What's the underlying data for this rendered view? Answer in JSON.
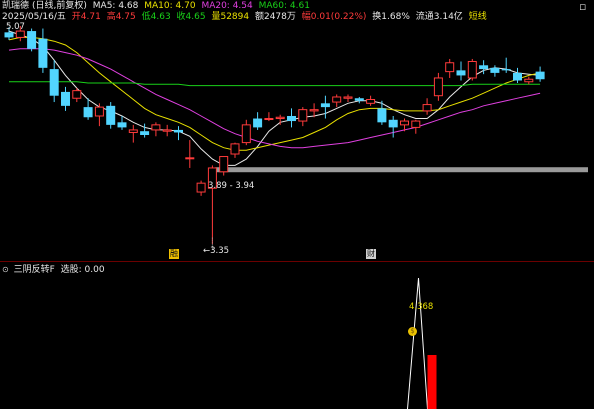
{
  "header": {
    "stock": "凯瑞德",
    "period_adj": "(日线,前复权)",
    "ma5": "MA5: 4.68",
    "ma10": "MA10: 4.70",
    "ma20": "MA20: 4.54",
    "ma60": "MA60: 4.61"
  },
  "info": {
    "date": "2025/05/16/五",
    "open": "开4.71",
    "high": "高4.75",
    "low": "低4.63",
    "close": "收4.65",
    "volume": "量52894",
    "amount": "额2478万",
    "change": "幅0.01(0.22%)",
    "turnover": "换1.68%",
    "float_cap": "流通3.14亿",
    "extra": "短线"
  },
  "chart": {
    "price_labels": [
      "5.07",
      "3.89 - 3.94",
      "3.35"
    ],
    "markers": [
      "融",
      "财"
    ]
  },
  "indicator": {
    "name": "三阴反转F",
    "value_label": "选股: 0.00",
    "peak_label": "4.368"
  },
  "colors": {
    "up": "#ff3b3b",
    "down": "#52d5ff",
    "ma5": "#e8e8e8",
    "ma10": "#e8e000",
    "ma20": "#e040e0",
    "ma60": "#19d119",
    "support_band": "#9a9a9a"
  },
  "icons": [
    "minimize-icon",
    "settings-dot-icon"
  ],
  "chart_data": {
    "type": "candlestick",
    "price_high_label": 5.07,
    "price_low_label": 3.35,
    "support_band": [
      3.89,
      3.94
    ],
    "candles_ohlc": [
      [
        5.02,
        5.06,
        4.96,
        4.98
      ],
      [
        4.98,
        5.07,
        4.95,
        5.03
      ],
      [
        5.03,
        5.05,
        4.87,
        4.89
      ],
      [
        4.97,
        5.05,
        4.7,
        4.74
      ],
      [
        4.73,
        4.8,
        4.47,
        4.52
      ],
      [
        4.55,
        4.59,
        4.4,
        4.44
      ],
      [
        4.5,
        4.58,
        4.47,
        4.56
      ],
      [
        4.43,
        4.5,
        4.33,
        4.35
      ],
      [
        4.36,
        4.46,
        4.28,
        4.43
      ],
      [
        4.44,
        4.47,
        4.26,
        4.29
      ],
      [
        4.31,
        4.36,
        4.25,
        4.27
      ],
      [
        4.23,
        4.29,
        4.15,
        4.25
      ],
      [
        4.24,
        4.3,
        4.19,
        4.21
      ],
      [
        4.25,
        4.31,
        4.2,
        4.29
      ],
      [
        4.24,
        4.29,
        4.2,
        4.25
      ],
      [
        4.25,
        4.28,
        4.17,
        4.23
      ],
      [
        4.03,
        4.17,
        3.95,
        4.03
      ],
      [
        3.76,
        3.85,
        3.73,
        3.83
      ],
      [
        3.79,
        3.97,
        3.35,
        3.95
      ],
      [
        3.92,
        4.04,
        3.89,
        4.04
      ],
      [
        4.06,
        4.15,
        4.03,
        4.14
      ],
      [
        4.15,
        4.33,
        4.13,
        4.29
      ],
      [
        4.34,
        4.39,
        4.25,
        4.27
      ],
      [
        4.34,
        4.39,
        4.32,
        4.34
      ],
      [
        4.34,
        4.37,
        4.29,
        4.35
      ],
      [
        4.36,
        4.42,
        4.27,
        4.32
      ],
      [
        4.32,
        4.43,
        4.28,
        4.41
      ],
      [
        4.4,
        4.46,
        4.35,
        4.41
      ],
      [
        4.46,
        4.52,
        4.34,
        4.43
      ],
      [
        4.47,
        4.53,
        4.43,
        4.51
      ],
      [
        4.5,
        4.53,
        4.47,
        4.51
      ],
      [
        4.5,
        4.51,
        4.46,
        4.48
      ],
      [
        4.46,
        4.52,
        4.44,
        4.49
      ],
      [
        4.42,
        4.48,
        4.29,
        4.31
      ],
      [
        4.33,
        4.36,
        4.19,
        4.27
      ],
      [
        4.29,
        4.34,
        4.24,
        4.32
      ],
      [
        4.27,
        4.33,
        4.22,
        4.32
      ],
      [
        4.4,
        4.5,
        4.37,
        4.45
      ],
      [
        4.52,
        4.7,
        4.48,
        4.66
      ],
      [
        4.71,
        4.81,
        4.66,
        4.78
      ],
      [
        4.72,
        4.79,
        4.64,
        4.68
      ],
      [
        4.66,
        4.81,
        4.64,
        4.79
      ],
      [
        4.76,
        4.8,
        4.69,
        4.73
      ],
      [
        4.74,
        4.76,
        4.67,
        4.7
      ],
      [
        4.73,
        4.82,
        4.7,
        4.72
      ],
      [
        4.7,
        4.74,
        4.62,
        4.64
      ],
      [
        4.63,
        4.67,
        4.61,
        4.65
      ],
      [
        4.71,
        4.75,
        4.63,
        4.65
      ]
    ],
    "ma_lines": {
      "MA5": [
        5.03,
        5.0,
        4.97,
        4.91,
        4.8,
        4.68,
        4.58,
        4.49,
        4.43,
        4.4,
        4.36,
        4.31,
        4.27,
        4.25,
        4.25,
        4.24,
        4.2,
        4.1,
        4.02,
        3.97,
        3.97,
        4.02,
        4.12,
        4.24,
        4.31,
        4.33,
        4.35,
        4.36,
        4.38,
        4.42,
        4.46,
        4.48,
        4.48,
        4.46,
        4.41,
        4.37,
        4.34,
        4.34,
        4.41,
        4.51,
        4.59,
        4.67,
        4.72,
        4.74,
        4.73,
        4.7,
        4.69,
        4.68
      ],
      "MA10": [
        4.96,
        4.98,
        4.98,
        4.97,
        4.95,
        4.92,
        4.86,
        4.78,
        4.7,
        4.63,
        4.56,
        4.49,
        4.42,
        4.37,
        4.34,
        4.31,
        4.27,
        4.21,
        4.15,
        4.11,
        4.09,
        4.09,
        4.11,
        4.13,
        4.15,
        4.17,
        4.19,
        4.23,
        4.27,
        4.33,
        4.38,
        4.41,
        4.42,
        4.42,
        4.41,
        4.4,
        4.4,
        4.4,
        4.41,
        4.44,
        4.47,
        4.5,
        4.54,
        4.58,
        4.62,
        4.65,
        4.68,
        4.7
      ],
      "MA20": [
        4.88,
        4.89,
        4.89,
        4.89,
        4.88,
        4.86,
        4.84,
        4.81,
        4.77,
        4.73,
        4.68,
        4.63,
        4.58,
        4.53,
        4.49,
        4.45,
        4.41,
        4.36,
        4.31,
        4.26,
        4.22,
        4.19,
        4.16,
        4.14,
        4.12,
        4.11,
        4.11,
        4.12,
        4.13,
        4.14,
        4.15,
        4.17,
        4.19,
        4.21,
        4.23,
        4.25,
        4.27,
        4.3,
        4.33,
        4.36,
        4.39,
        4.41,
        4.44,
        4.46,
        4.48,
        4.5,
        4.52,
        4.54
      ],
      "MA60": [
        4.63,
        4.63,
        4.63,
        4.63,
        4.63,
        4.63,
        4.63,
        4.62,
        4.62,
        4.62,
        4.62,
        4.62,
        4.61,
        4.61,
        4.61,
        4.61,
        4.6,
        4.6,
        4.6,
        4.6,
        4.6,
        4.6,
        4.6,
        4.6,
        4.6,
        4.6,
        4.6,
        4.6,
        4.6,
        4.6,
        4.6,
        4.6,
        4.6,
        4.6,
        4.6,
        4.6,
        4.6,
        4.6,
        4.6,
        4.6,
        4.6,
        4.61,
        4.61,
        4.61,
        4.61,
        4.61,
        4.61,
        4.61
      ]
    },
    "indicator": {
      "name": "三阴反转F",
      "spike_peak_value": 4.368,
      "bar_present": true
    }
  }
}
